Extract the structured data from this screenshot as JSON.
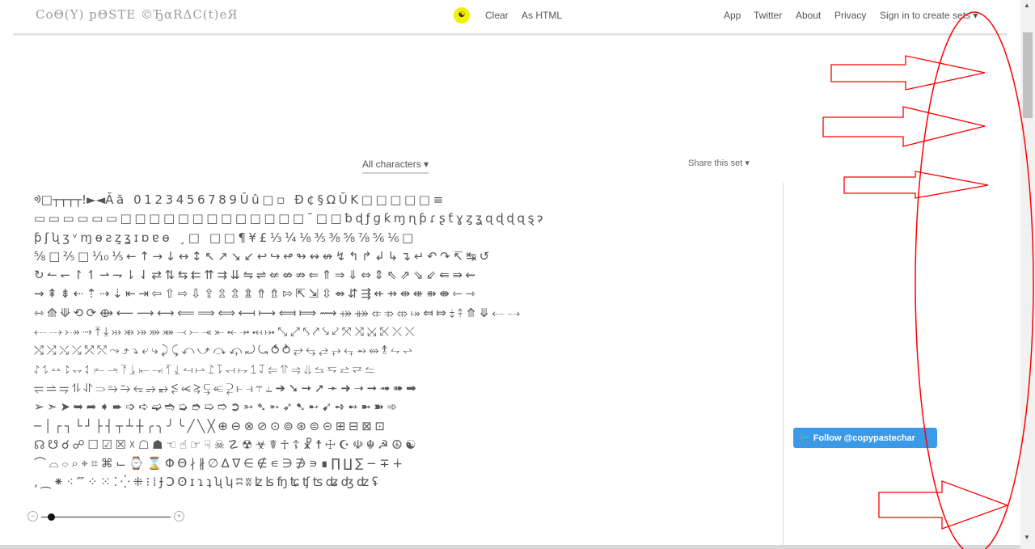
{
  "header": {
    "logo": "CoΘ(Y) pΘSTE ©ЂαRΔC(t)eЯ",
    "theme_icon": "☯",
    "links_center": [
      "Clear",
      "As HTML"
    ],
    "links_right": [
      "App",
      "Twitter",
      "About",
      "Privacy",
      "Sign in to create sets ▾"
    ]
  },
  "toolbar": {
    "category_label": "All characters ▾",
    "share_label": "Share this set ▾"
  },
  "grid": {
    "rows": [
      "ᢀ□┬┬┬┬!►◄Ăă 0123456789Ûû□▫ Ð¢§ΩŬK□□□□□≡",
      "▭▭▭▭▭▭□□□□□□□□□□□□□¯□□ƀɖƒɡƙɱɳƥɾʂƭɣȥʓɋɖɖɋȿɂ",
      "ƥʃʯʒᵛɱɵƨȥʓɪɒɐɵ ¸□ □□¶¥£⅓¼⅛⅗⅜⅝⅞⅚⅙□",
      "⅝□⅖□⅒⅕←↑→↓↔↕↖↗↘↙↩↪↫↬↭↮↯↰↱↲↳↴↵↶↷↸↹↺",
      "↻↼↽↾↿⇀⇁⇂⇃⇄⇅⇆⇇⇈⇉⇊⇋⇌⇍⇎⇏⇐⇑⇒⇓⇔⇕⇖⇗⇘⇙⇚⇛⇜",
      "⇝⇞⇟⇠⇡⇢⇣⇤⇥⇦⇧⇨⇩⇪⇫⇬⇭⇮⇯⇰⇱⇲⇳⇴⇵⇶⇷⇸⇹⇺⇻⇼⇽⇾",
      "⇿⟰⟱⟲⟳⟴⟵⟶⟷⟸⟹⟺⟻⟼⟽⟾⟿⤀⤁⤂⤃⤄⤅⤆⤇⤈⤉⤊⤋⤌⤍",
      "⤎⤏⤐⤑⤒⤓⤔⤕⤖⤗⤘⤙⤚⤛⤜⤝⤞⤟⤠⤡⤢⤣⤤⤥⤦⤧⤨⤩⤪⤫⤬",
      "⤭⤮⤯⤰⤱⤲⤳⤴⤵⤶⤷⤸⤹⤺⤻⤼⤽⤾⤿⥀⥁⥂⥃⥄⥅⥆⥇⥈⥉⥊⥋",
      "⥌⥍⥎⥏⥐⥑⥒⥓⥔⥕⥖⥗⥘⥙⥚⥛⥜⥝⥞⥟⥠⥡⥢⥣⥤⥥⥦⥧⥨⥩⥪",
      "⥫⥬⥭⥮⥯⥰⥱⥲⥳⥴⥵⥶⥷⥸⥹⥺⥻⥼⥽⥾⥿➔➘➙➚➛➜➝➞➟➠➡",
      "➢➣➤➥➦➧➨➩➪➫➬➭➮➯➱➲➳➴➵➶➷➸➹➺➻➼➽➾",
      "─│┌┐└┘├┤┬┴┼╭╮╯╰╱╲╳⊕⊖⊗⊘⊙⊚⊛⊜⊝⊞⊟⊠⊡",
      "☊☋☌☍☐☑☒☓☖☗☜☝☞☟☠☡☢☣☤☥☦☧☨☩☪☫☬☭☮☯",
      "⌒⌓⌔⌕⌖⌗⌘⌙⌚⌛ΦΘ∤∦∅∆∇∈∉∊∋∌∍∎∏∐∑−∓∔",
      "‚⁔⁕⁖⁗⁘⁙⁚⁛⁜⁝⁞ɈƆʘɪɿʇʯʮʭʬʫʪʩʨʧʦʥʤʣʢ"
    ]
  },
  "zoom": {
    "level": 0.05
  },
  "social": {
    "follow_label": "Follow @copypastechar",
    "bird_icon": "🐦",
    "brand_color": "#3b99e8"
  },
  "annotation": {
    "color": "#ff0000"
  }
}
